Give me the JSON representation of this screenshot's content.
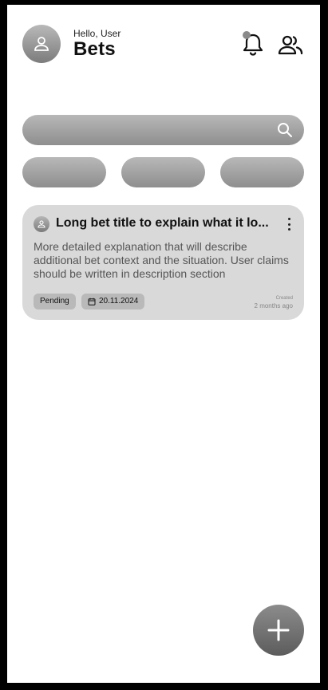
{
  "header": {
    "greeting": "Hello, User",
    "title": "Bets",
    "avatar_icon": "user-icon",
    "notification_icon": "bell-icon",
    "people_icon": "people-icon",
    "has_unread_notifications": true
  },
  "search": {
    "value": "",
    "placeholder": "",
    "icon": "search-icon"
  },
  "filters": [
    {
      "label": ""
    },
    {
      "label": ""
    },
    {
      "label": ""
    }
  ],
  "bets": [
    {
      "title": "Long bet title to explain what it lo...",
      "description": "More detailed explanation that will describe additional bet context and the situation. User claims should be written in description section",
      "status": "Pending",
      "date": "20.11.2024",
      "created_label": "Created",
      "created_value": "2 months ago",
      "menu_icon": "more-vertical-icon",
      "date_icon": "calendar-icon"
    }
  ],
  "fab": {
    "icon": "plus-icon"
  },
  "colors": {
    "background": "#ffffff",
    "card": "#d9d9d9",
    "chip": "#b9b9b9",
    "text_primary": "#111111",
    "text_secondary": "#555555"
  }
}
